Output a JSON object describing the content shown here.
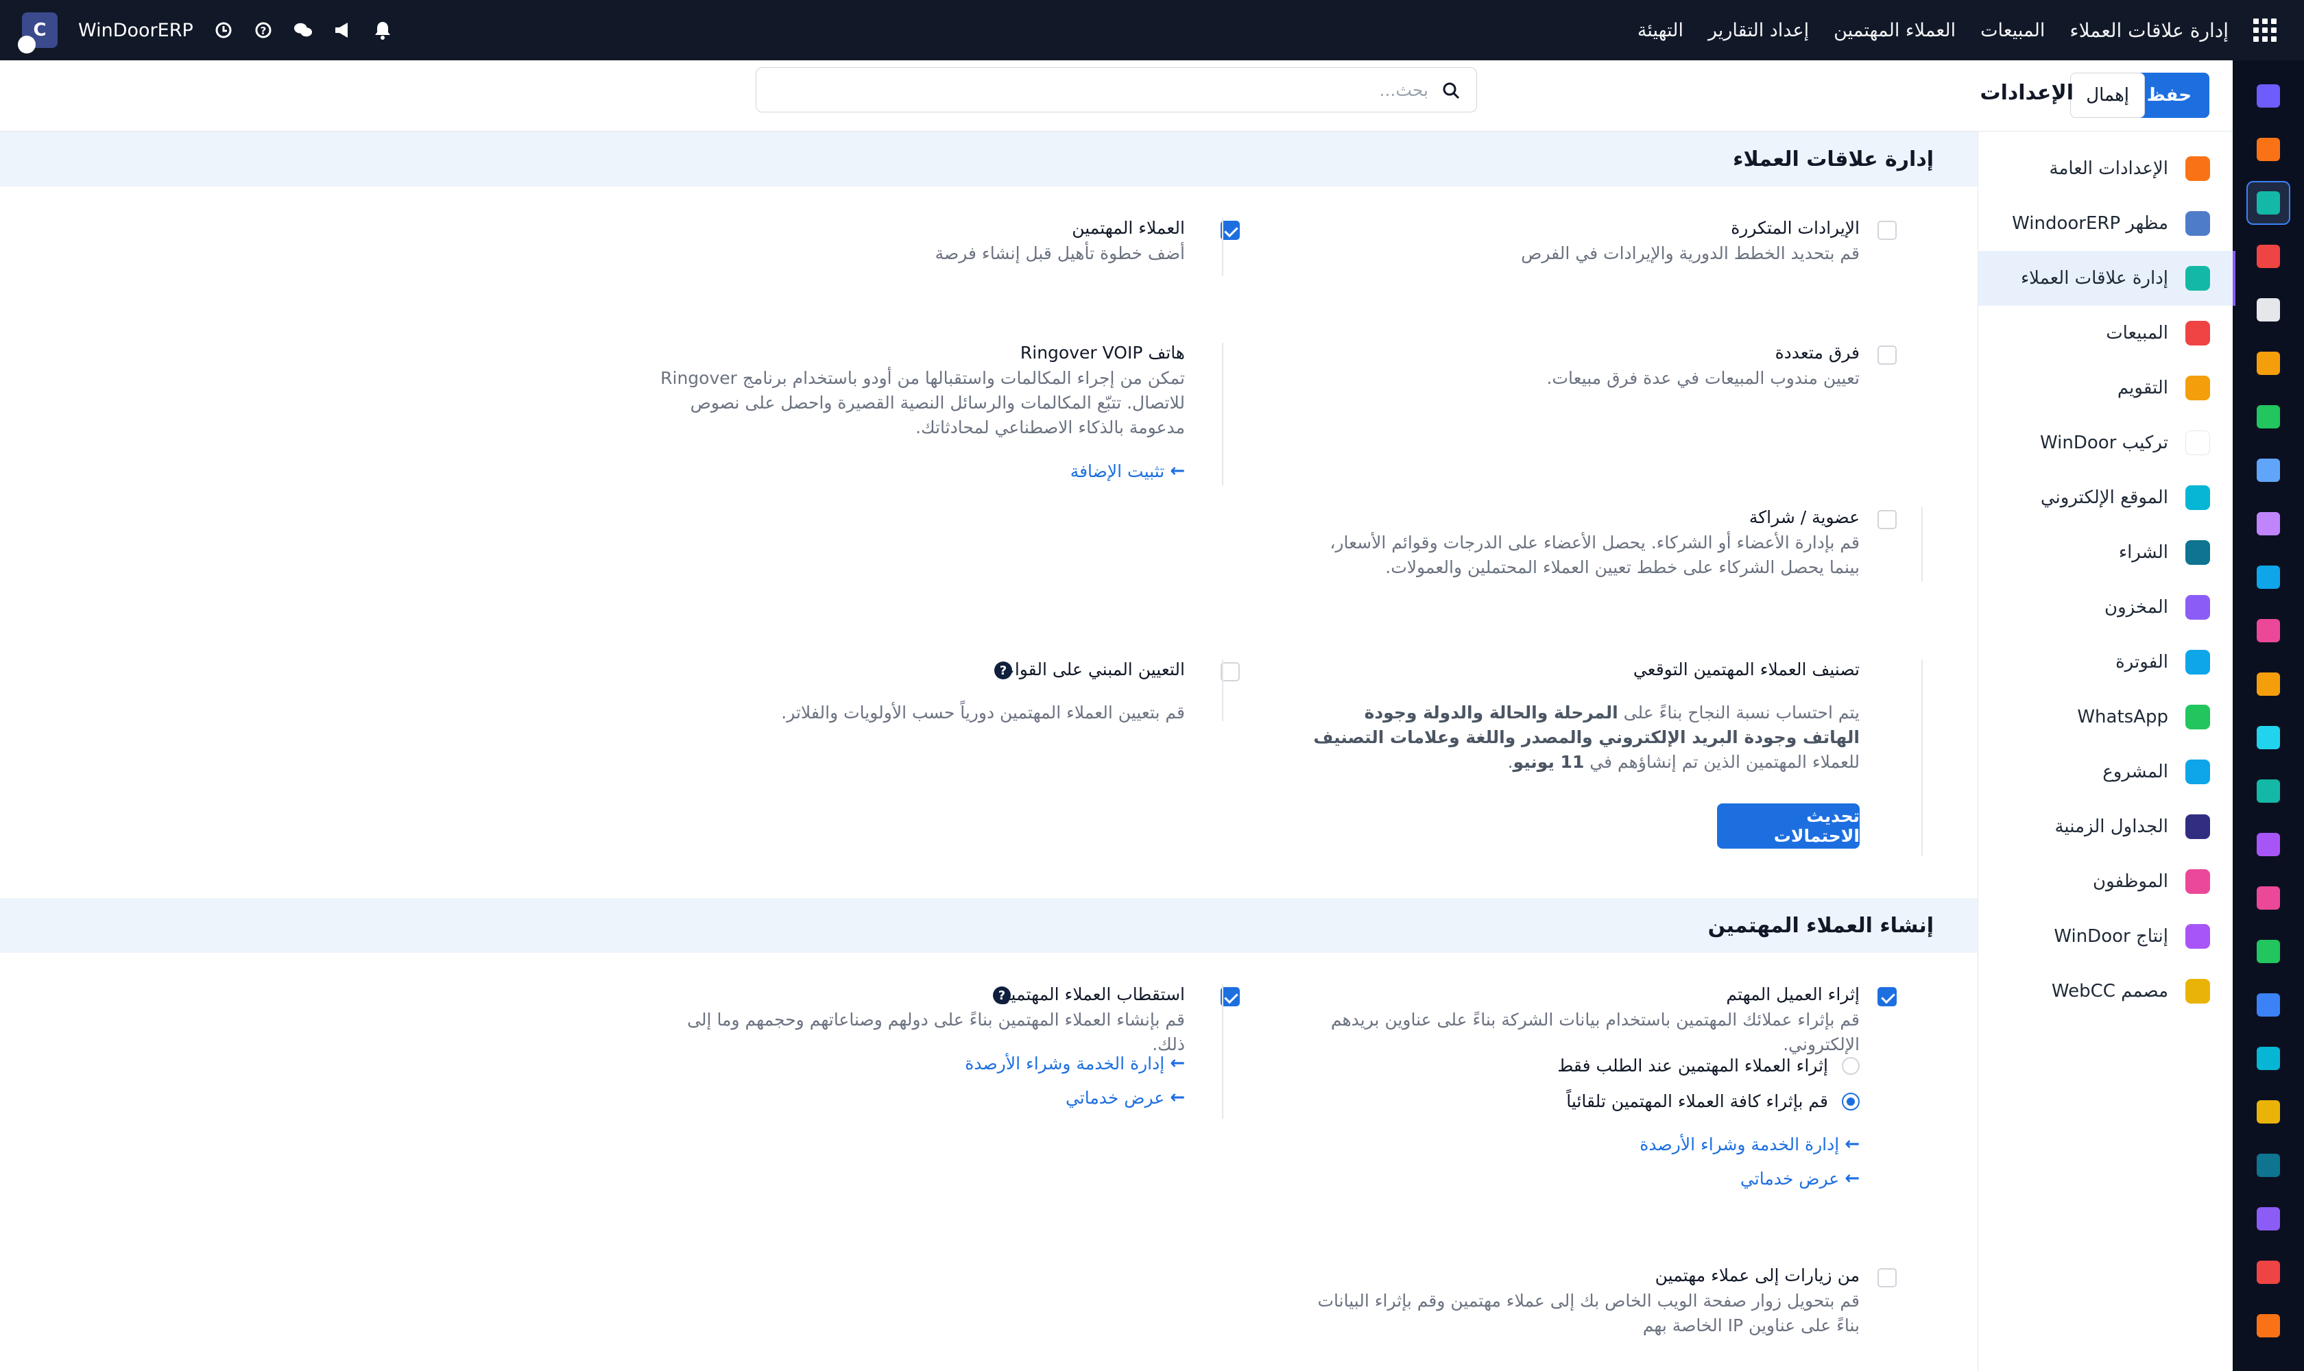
{
  "topbar": {
    "apps_icon": "apps-grid-icon",
    "nav": [
      "إدارة علاقات العملاء",
      "المبيعات",
      "العملاء المهتمين",
      "إعداد التقارير",
      "التهيئة"
    ],
    "company": "WinDoorERP",
    "avatar_letter": "C"
  },
  "control": {
    "save_label": "حفظ",
    "discard_label": "إهمال",
    "title": "الإعدادات",
    "search_placeholder": "بحث..."
  },
  "sidebar": {
    "items": [
      {
        "label": "الإعدادات العامة",
        "color": "#f97316"
      },
      {
        "label": "مظهر WindoorERP",
        "color": "#4f7cc9"
      },
      {
        "label": "إدارة علاقات العملاء",
        "color": "#14b8a6"
      },
      {
        "label": "المبيعات",
        "color": "#ef4444"
      },
      {
        "label": "التقويم",
        "color": "#f59e0b"
      },
      {
        "label": "تركيب WinDoor",
        "color": "#ffffff"
      },
      {
        "label": "الموقع الإلكتروني",
        "color": "#06b6d4"
      },
      {
        "label": "الشراء",
        "color": "#0e7490"
      },
      {
        "label": "المخزون",
        "color": "#8b5cf6"
      },
      {
        "label": "الفوترة",
        "color": "#0ea5e9"
      },
      {
        "label": "WhatsApp",
        "color": "#22c55e"
      },
      {
        "label": "المشروع",
        "color": "#0ea5e9"
      },
      {
        "label": "الجداول الزمنية",
        "color": "#312e81"
      },
      {
        "label": "الموظفون",
        "color": "#ec4899"
      },
      {
        "label": "إنتاج WinDoor",
        "color": "#a855f7"
      },
      {
        "label": "مصمم WebCC",
        "color": "#eab308"
      }
    ]
  },
  "rail": {
    "colors": [
      "#6d5dfc",
      "#f97316",
      "#14b8a6",
      "#ef4444",
      "#e5e7eb",
      "#f59e0b",
      "#22c55e",
      "#60a5fa",
      "#c084fc",
      "#0ea5e9",
      "#ec4899",
      "#f59e0b",
      "#22d3ee",
      "#14b8a6",
      "#a855f7",
      "#ec4899",
      "#22c55e",
      "#3b82f6",
      "#06b6d4",
      "#eab308",
      "#0e7490",
      "#8b5cf6",
      "#ef4444",
      "#f97316"
    ]
  },
  "crm": {
    "section_title": "إدارة علاقات العملاء",
    "recurring_title": "الإيرادات المتكررة",
    "recurring_desc": "قم بتحديد الخطط الدورية والإيرادات في الفرص",
    "leads_title": "العملاء المهتمين",
    "leads_desc": "أضف خطوة تأهيل قبل إنشاء فرصة",
    "multi_teams_title": "فرق متعددة",
    "multi_teams_desc": "تعيين مندوب المبيعات في عدة فرق مبيعات.",
    "voip_title": "هاتف Ringover VOIP",
    "voip_desc": "تمكن من إجراء المكالمات واستقبالها من أودو باستخدام برنامج Ringover للاتصال. تتبّع المكالمات والرسائل النصية القصيرة واحصل على نصوص مدعومة بالذكاء الاصطناعي لمحادثاتك.",
    "voip_link": "تثبيت الإضافة",
    "membership_title": "عضوية / شراكة",
    "membership_desc": "قم بإدارة الأعضاء أو الشركاء. يحصل الأعضاء على الدرجات وقوائم الأسعار، بينما يحصل الشركاء على خطط تعيين العملاء المحتملين والعمولات.",
    "pls_title": "تصنيف العملاء المهتمين التوقعي",
    "pls_desc_1": "يتم احتساب نسبة النجاح بناءً على ",
    "pls_desc_bold": "المرحلة والحالة والدولة وجودة الهاتف وجودة البريد الإلكتروني والمصدر واللغة وعلامات التصنيف",
    "pls_desc_2": " للعملاء المهتمين الذين تم إنشاؤهم في ",
    "pls_date": "11 يونيو",
    "pls_button": "تحديث الاحتمالات",
    "rule_title": "التعيين المبني على القواعد",
    "rule_desc": "قم بتعيين العملاء المهتمين دورياً حسب الأولويات والفلاتر."
  },
  "lead_gen": {
    "section_title": "إنشاء العملاء المهتمين",
    "enrich_title": "إثراء العميل المهتم",
    "enrich_desc": "قم بإثراء عملائك المهتمين باستخدام بيانات الشركة بناءً على عناوين بريدهم الإلكتروني.",
    "enrich_opt1": "إثراء العملاء المهتمين عند الطلب فقط",
    "enrich_opt2": "قم بإثراء كافة العملاء المهتمين تلقائياً",
    "enrich_link1": "إدارة الخدمة وشراء الأرصدة",
    "enrich_link2": "عرض خدماتي",
    "mining_title": "استقطاب العملاء المهتمين",
    "mining_desc": "قم بإنشاء العملاء المهتمين بناءً على دولهم وصناعاتهم وحجمهم وما إلى ذلك.",
    "mining_link1": "إدارة الخدمة وشراء الأرصدة",
    "mining_link2": "عرض خدماتي",
    "visits_title": "من زيارات إلى عملاء مهتمين",
    "visits_desc": "قم بتحويل زوار صفحة الويب الخاص بك إلى عملاء مهتمين وقم بإثراء البيانات بناءً على عناوين IP الخاصة بهم"
  }
}
